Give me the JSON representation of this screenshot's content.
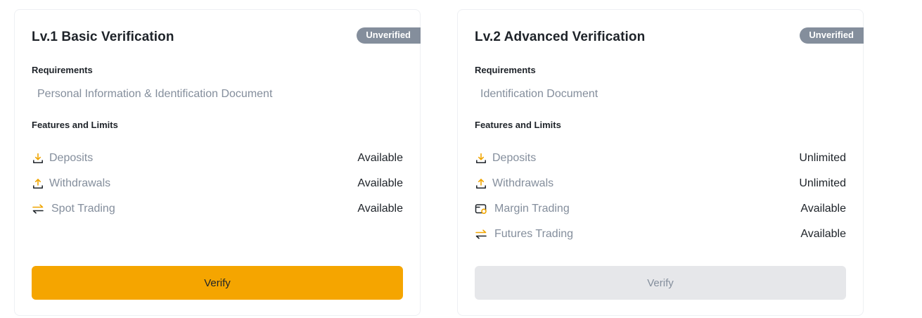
{
  "cards": [
    {
      "title": "Lv.1 Basic Verification",
      "badge": "Unverified",
      "requirements_label": "Requirements",
      "requirements_text": "Personal Information & Identification Document",
      "features_label": "Features and Limits",
      "features": [
        {
          "icon": "deposit-icon",
          "name": "Deposits",
          "value": "Available"
        },
        {
          "icon": "withdraw-icon",
          "name": "Withdrawals",
          "value": "Available"
        },
        {
          "icon": "swap-icon",
          "name": "Spot Trading",
          "value": "Available"
        }
      ],
      "button_label": "Verify",
      "button_state": "enabled"
    },
    {
      "title": "Lv.2 Advanced Verification",
      "badge": "Unverified",
      "requirements_label": "Requirements",
      "requirements_text": "Identification Document",
      "features_label": "Features and Limits",
      "features": [
        {
          "icon": "deposit-icon",
          "name": "Deposits",
          "value": "Unlimited"
        },
        {
          "icon": "withdraw-icon",
          "name": "Withdrawals",
          "value": "Unlimited"
        },
        {
          "icon": "margin-wallet-icon",
          "name": "Margin Trading",
          "value": "Available"
        },
        {
          "icon": "swap-icon",
          "name": "Futures Trading",
          "value": "Available"
        }
      ],
      "button_label": "Verify",
      "button_state": "disabled"
    }
  ],
  "colors": {
    "accent": "#f5a500",
    "badge_bg": "#848e9c",
    "text_primary": "#1e2329",
    "text_secondary": "#848e9c",
    "button_disabled_bg": "#e6e7ea"
  }
}
